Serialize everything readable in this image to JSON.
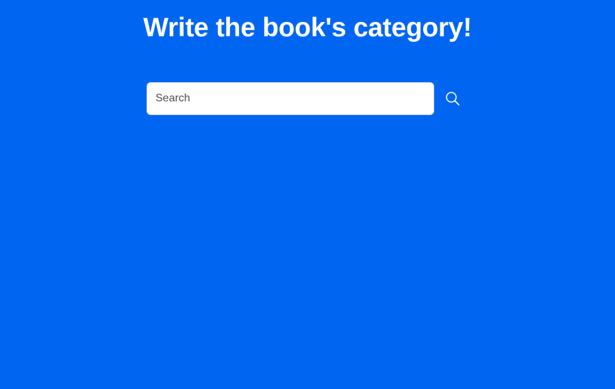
{
  "header": {
    "title": "Write the book's category!"
  },
  "search": {
    "value": "",
    "placeholder": "Search",
    "button_icon": "search-icon"
  },
  "colors": {
    "background": "#0066f2",
    "title_text": "#ffffff",
    "input_background": "#ffffff",
    "icon": "#ffffff"
  }
}
